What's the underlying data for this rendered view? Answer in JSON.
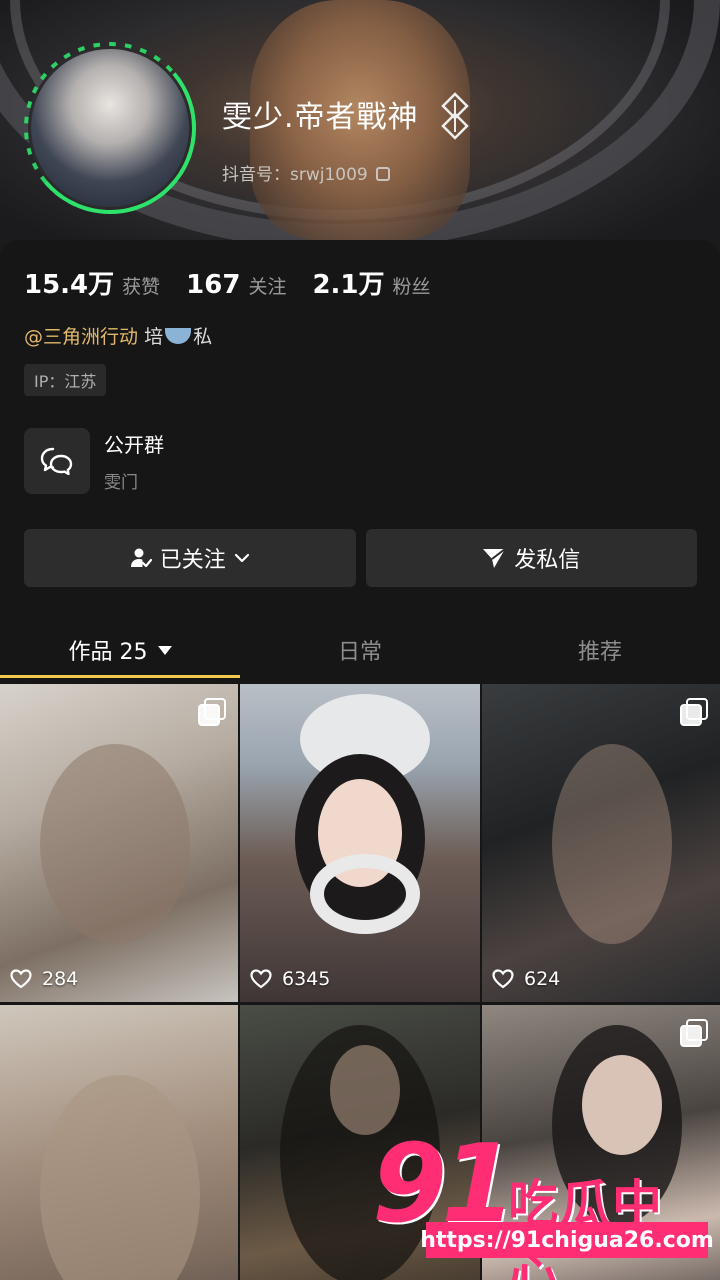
{
  "profile": {
    "name": "雯少.帝者戰神",
    "douyin_id": "抖音号：srwj1009",
    "stats": [
      {
        "value": "15.4万",
        "label": "获赞"
      },
      {
        "value": "167",
        "label": "关注"
      },
      {
        "value": "2.1万",
        "label": "粉丝"
      }
    ],
    "bio_mention": "@三角洲行动",
    "bio_text_1": "培",
    "bio_text_2": "私",
    "ip": "IP：江苏",
    "group": {
      "title": "公开群",
      "subtitle": "雯门"
    }
  },
  "actions": {
    "follow_label": "已关注",
    "message_label": "发私信"
  },
  "tabs": [
    {
      "label": "作品 25",
      "active": true
    },
    {
      "label": "日常",
      "active": false
    },
    {
      "label": "推荐",
      "active": false
    }
  ],
  "posts": [
    {
      "likes": "284",
      "multi": true
    },
    {
      "likes": "6345",
      "multi": false
    },
    {
      "likes": "624",
      "multi": true
    },
    {
      "likes": "",
      "multi": false
    },
    {
      "likes": "",
      "multi": false
    },
    {
      "likes": "",
      "multi": true
    }
  ],
  "watermark": {
    "number": "91",
    "text": "吃瓜中心",
    "url": "https://91chigua26.com"
  },
  "colors": {
    "accent_gold": "#e2b869",
    "tab_underline": "#f2c94c",
    "avatar_ring": "#2ee26a",
    "watermark_pink": "#ff2d74"
  }
}
